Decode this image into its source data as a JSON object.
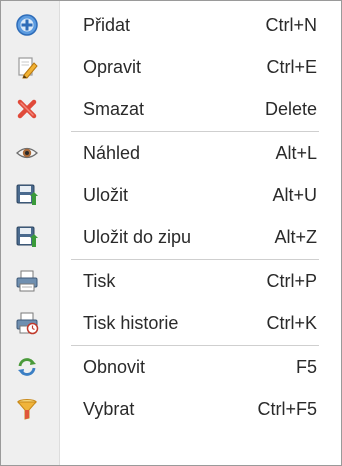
{
  "menu": {
    "items": [
      {
        "label": "Přidat",
        "shortcut": "Ctrl+N",
        "icon": "add-icon"
      },
      {
        "label": "Opravit",
        "shortcut": "Ctrl+E",
        "icon": "edit-icon"
      },
      {
        "label": "Smazat",
        "shortcut": "Delete",
        "icon": "delete-icon"
      },
      {
        "label": "Náhled",
        "shortcut": "Alt+L",
        "icon": "preview-icon"
      },
      {
        "label": "Uložit",
        "shortcut": "Alt+U",
        "icon": "save-icon"
      },
      {
        "label": "Uložit do zipu",
        "shortcut": "Alt+Z",
        "icon": "save-zip-icon"
      },
      {
        "label": "Tisk",
        "shortcut": "Ctrl+P",
        "icon": "print-icon"
      },
      {
        "label": "Tisk historie",
        "shortcut": "Ctrl+K",
        "icon": "print-history-icon"
      },
      {
        "label": "Obnovit",
        "shortcut": "F5",
        "icon": "refresh-icon"
      },
      {
        "label": "Vybrat",
        "shortcut": "Ctrl+F5",
        "icon": "filter-icon"
      }
    ]
  }
}
